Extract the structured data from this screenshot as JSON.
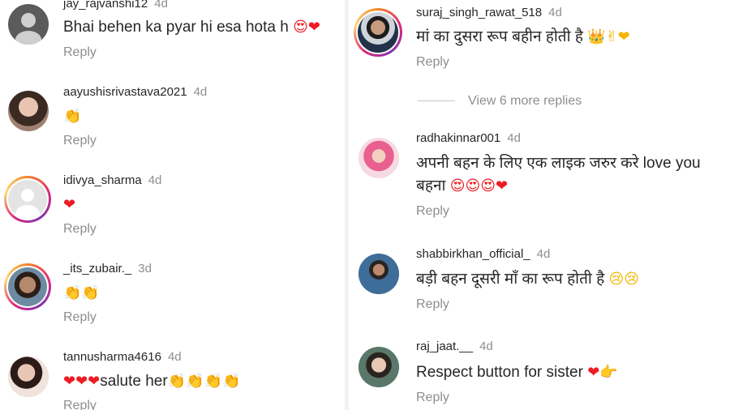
{
  "left": [
    {
      "username": "jay_rajvanshi12",
      "time": "4d",
      "text": "Bhai behen ka pyar hi esa hota h",
      "emojis": "😍❤",
      "reply": "Reply"
    },
    {
      "username": "aayushisrivastava2021",
      "time": "4d",
      "text": "",
      "emojis": "👏",
      "reply": "Reply"
    },
    {
      "username": "idivya_sharma",
      "time": "4d",
      "text": "",
      "emojis": "❤",
      "reply": "Reply"
    },
    {
      "username": "_its_zubair._",
      "time": "3d",
      "text": "",
      "emojis": "👏👏",
      "reply": "Reply"
    },
    {
      "username": "tannusharma4616",
      "time": "4d",
      "text": "salute her",
      "emojis_before": "❤❤❤",
      "emojis": "👏👏👏👏",
      "reply": "Reply"
    }
  ],
  "right": [
    {
      "username": "suraj_singh_rawat_518",
      "time": "4d",
      "text": "मां का दुसरा रूप बहीन होती है",
      "emojis": "👑✌❤",
      "reply": "Reply"
    },
    {
      "view_more": "View 6 more replies"
    },
    {
      "username": "radhakinnar001",
      "time": "4d",
      "text": "अपनी बहन के लिए एक लाइक जरुर करे love you",
      "text2": "बहना",
      "emojis": "😍😍😍❤",
      "reply": "Reply"
    },
    {
      "username": "shabbirkhan_official_",
      "time": "4d",
      "text": "बड़ी बहन दूसरी माँ का रूप होती है",
      "emojis": "😢😢",
      "reply": "Reply"
    },
    {
      "username": "raj_jaat.__",
      "time": "4d",
      "text": "Respect button for sister",
      "emojis": "❤👉",
      "reply": "Reply"
    }
  ],
  "colors": {
    "text": "#262626",
    "meta": "#8e8e8e",
    "heart": "#ed1c24",
    "divider": "#f2f2f2"
  }
}
